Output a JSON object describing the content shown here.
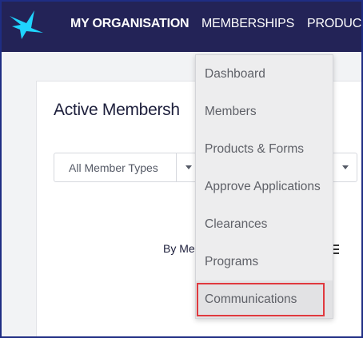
{
  "topbar": {
    "org_label": "MY ORGANISATION",
    "memberships_label": "MEMBERSHIPS",
    "products_label": "PRODUCT",
    "logo_color": "#1fd4ff"
  },
  "page": {
    "title": "Active Membersh",
    "filter_type": "All Member Types",
    "by_label": "By Me"
  },
  "dropdown": {
    "items": [
      {
        "label": "Dashboard"
      },
      {
        "label": "Members"
      },
      {
        "label": "Products & Forms"
      },
      {
        "label": "Approve Applications"
      },
      {
        "label": "Clearances"
      },
      {
        "label": "Programs"
      },
      {
        "label": "Communications"
      }
    ],
    "highlighted_item": "Communications",
    "highlight_color": "#e0393e"
  }
}
